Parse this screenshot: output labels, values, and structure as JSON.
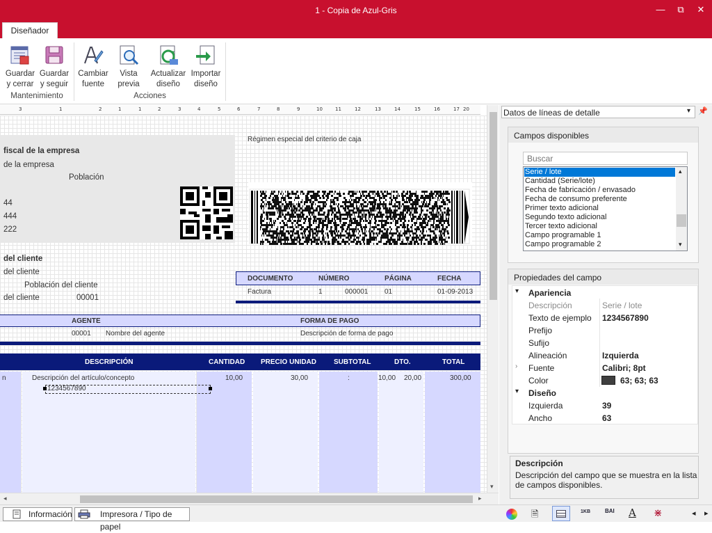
{
  "window": {
    "title": "1 - Copia de Azul-Gris",
    "minimize": "—",
    "maximize": "□",
    "close": "✕",
    "restore": "⧉"
  },
  "ribbon": {
    "tab": "Diseñador",
    "groups": {
      "maintenance": "Mantenimiento",
      "actions": "Acciones"
    },
    "buttons": {
      "save_close": [
        "Guardar",
        "y cerrar"
      ],
      "save_continue": [
        "Guardar",
        "y seguir"
      ],
      "change_font": [
        "Cambiar",
        "fuente"
      ],
      "preview": [
        "Vista",
        "previa"
      ],
      "update_design": [
        "Actualizar",
        "diseño"
      ],
      "import_design": [
        "Importar",
        "diseño"
      ]
    }
  },
  "ruler": [
    "3",
    "1",
    "2",
    "1",
    "1",
    "2",
    "3",
    "4",
    "5",
    "6",
    "7",
    "8",
    "9",
    "10",
    "11",
    "12",
    "13",
    "14",
    "15",
    "16",
    "17",
    "18",
    "19",
    "20"
  ],
  "report": {
    "company": {
      "title": "fiscal de la empresa",
      "line1": "de la empresa",
      "city": "Población",
      "l3": "44",
      "l4": "444",
      "l5": "222"
    },
    "regime": "Régimen especial del criterio de caja",
    "client": {
      "title": "del cliente",
      "line1": "del cliente",
      "city": "Población del cliente",
      "line3": "del cliente",
      "code": "00001"
    },
    "docheader": {
      "headers": [
        "DOCUMENTO",
        "NÚMERO",
        "PÁGINA",
        "FECHA"
      ],
      "values": [
        "Factura",
        "1",
        "000001",
        "01",
        "01-09-2013"
      ]
    },
    "agent": {
      "h_agent": "AGENTE",
      "h_payment": "FORMA DE PAGO",
      "code": "00001",
      "name": "Nombre del agente",
      "payment": "Descripción de forma de pago"
    },
    "lines": {
      "headers": [
        "DESCRIPCIÓN",
        "CANTIDAD",
        "PRECIO UNIDAD",
        "SUBTOTAL",
        "DTO.",
        "TOTAL"
      ],
      "first_col": "n",
      "description": "Descripción del artículo/concepto",
      "sample": "1234567890",
      "quantity": "10,00",
      "price": "30,00",
      "subtotal": ":",
      "dto": "10,00",
      "dto2": "20,00",
      "total": "300,00"
    }
  },
  "bottom_tabs": {
    "info": "Información",
    "printer": "Impresora / Tipo de papel"
  },
  "right": {
    "dropdown": "Datos de líneas de detalle",
    "available_title": "Campos disponibles",
    "search_placeholder": "Buscar",
    "fields": [
      "Serie / lote",
      "Cantidad (Serie/lote)",
      "Fecha de  fabricación / envasado",
      "Fecha de  consumo preferente",
      "Primer texto adicional",
      "Segundo texto adicional",
      "Tercer texto adicional",
      "Campo programable 1",
      "Campo programable 2"
    ],
    "props_title": "Propiedades del campo",
    "appearance": "Apariencia",
    "design": "Diseño",
    "props": [
      {
        "label": "Descripción",
        "value": "Serie / lote"
      },
      {
        "label": "Texto de ejemplo",
        "value": "1234567890"
      },
      {
        "label": "Prefijo",
        "value": ""
      },
      {
        "label": "Sufijo",
        "value": ""
      },
      {
        "label": "Alineación",
        "value": "Izquierda"
      },
      {
        "label": "Fuente",
        "value": "Calibri; 8pt"
      },
      {
        "label": "Color",
        "value": "63; 63; 63"
      }
    ],
    "design_props": [
      {
        "label": "Izquierda",
        "value": "39"
      },
      {
        "label": "Ancho",
        "value": "63"
      }
    ],
    "desc_title": "Descripción",
    "desc_text": [
      "Descripción del campo que se muestra en la lista",
      "de campos disponibles."
    ],
    "icon_labels": [
      "1KB",
      "BAI"
    ],
    "colors": {
      "accent": "#c8102e",
      "navy": "#0a1a7a",
      "lavender": "#d6d8ff",
      "selected": "#0078d7",
      "swatch": "#3f3f3f"
    }
  }
}
